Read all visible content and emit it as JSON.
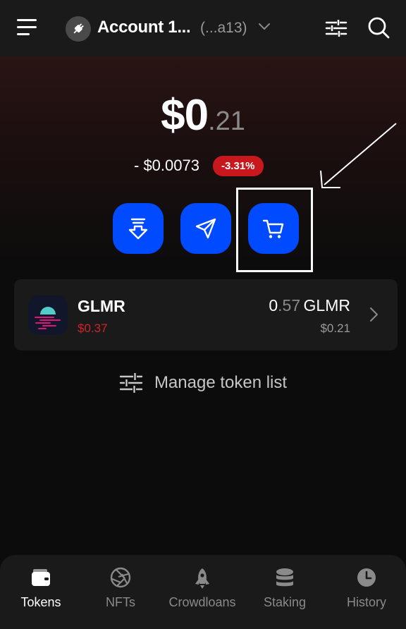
{
  "header": {
    "account_name": "Account 1...",
    "account_address": "(...a13)",
    "icons": [
      "menu-icon",
      "plug-icon",
      "chevron-down-icon",
      "sliders-icon",
      "search-icon"
    ]
  },
  "balance": {
    "integer": "$0",
    "fraction": ".21",
    "change_value": "- $0.0073",
    "change_percent": "-3.31%"
  },
  "actions": {
    "icons": [
      "receive-icon",
      "send-icon",
      "buy-cart-icon"
    ],
    "highlighted": "buy-cart-icon"
  },
  "tokens": [
    {
      "symbol": "GLMR",
      "price": "$0.37",
      "amount_int": "0",
      "amount_frac": ".57",
      "amount_symbol": "GLMR",
      "value": "$0.21"
    }
  ],
  "manage": {
    "label": "Manage token list"
  },
  "nav": [
    {
      "label": "Tokens",
      "icon": "wallet-icon",
      "active": true
    },
    {
      "label": "NFTs",
      "icon": "aperture-icon",
      "active": false
    },
    {
      "label": "Crowdloans",
      "icon": "rocket-icon",
      "active": false
    },
    {
      "label": "Staking",
      "icon": "coins-icon",
      "active": false
    },
    {
      "label": "History",
      "icon": "clock-icon",
      "active": false
    }
  ],
  "colors": {
    "accent": "#004bff",
    "negative": "#c8171d",
    "background": "#0c0c0c",
    "card": "#1a1a1a"
  }
}
